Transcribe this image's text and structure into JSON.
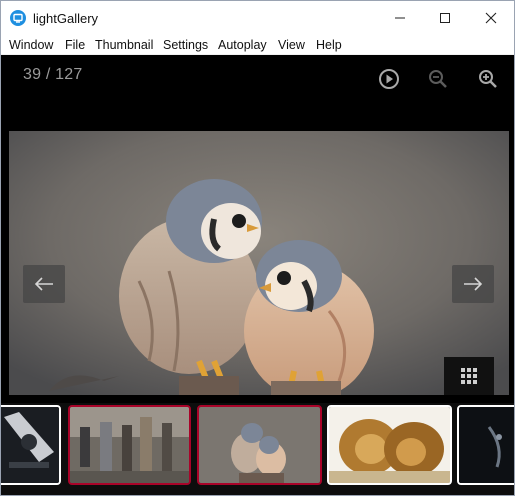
{
  "window": {
    "title": "lightGallery",
    "icon": "lightgallery-app-icon",
    "controls": [
      "minimize-icon",
      "maximize-icon",
      "close-icon"
    ]
  },
  "menu": {
    "items": [
      "Window",
      "File",
      "Thumbnail",
      "Settings",
      "Autoplay",
      "View",
      "Help"
    ]
  },
  "gallery": {
    "counter": "39 / 127",
    "toolbar": [
      "play-icon",
      "zoom-out-icon",
      "zoom-in-icon"
    ],
    "nav": [
      "arrow-left-icon",
      "arrow-right-icon"
    ],
    "thumbnail_toggle_icon": "grid-icon",
    "accent_color": "#a90329",
    "main_image": "two-kestrels-perched",
    "thumbnails": [
      {
        "subject": "guitar-dark",
        "selected": false
      },
      {
        "subject": "street-crowd",
        "selected": true
      },
      {
        "subject": "two-kestrels",
        "selected": true
      },
      {
        "subject": "lions",
        "selected": false
      },
      {
        "subject": "dark-abstract",
        "selected": false
      }
    ]
  }
}
